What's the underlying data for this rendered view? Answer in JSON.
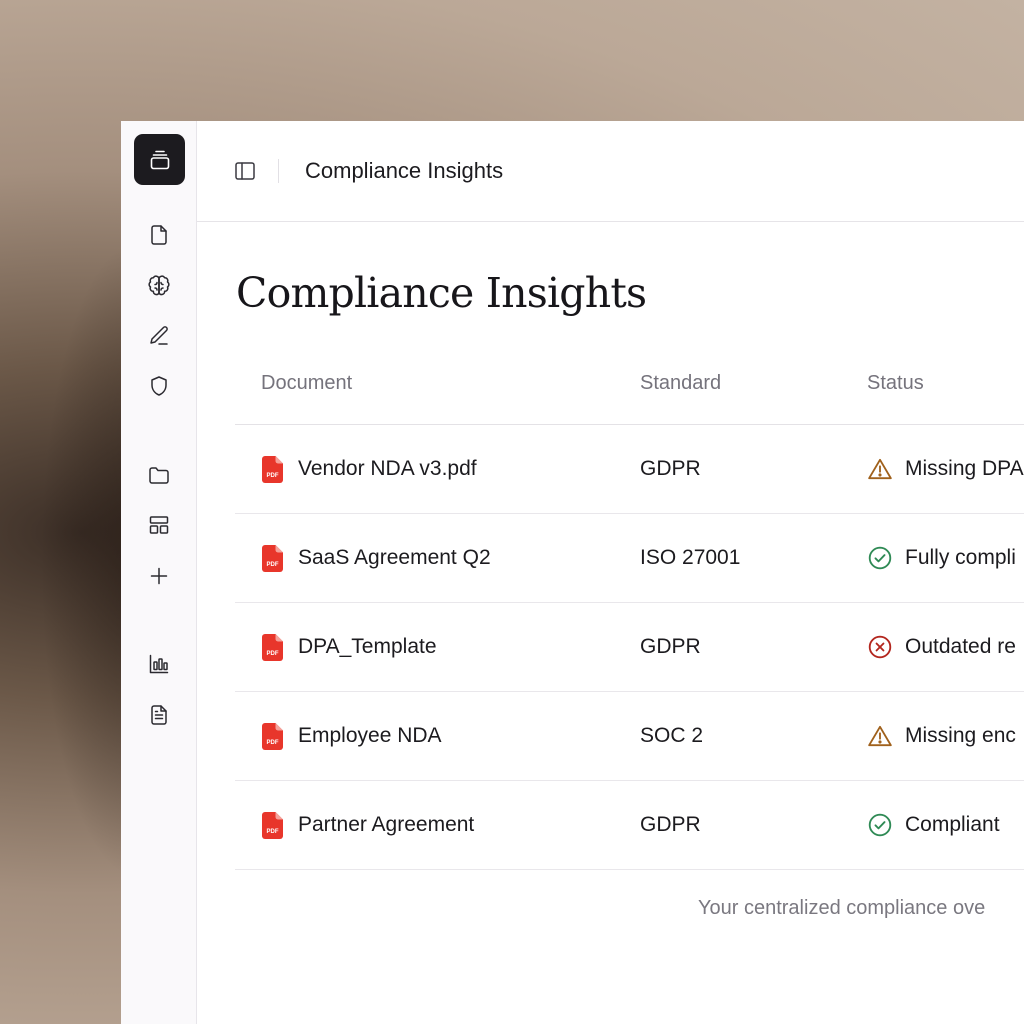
{
  "header": {
    "title": "Compliance Insights"
  },
  "page": {
    "title": "Compliance Insights"
  },
  "sidebar": {
    "logo": "stack-logo-icon",
    "items": [
      {
        "icon": "document-icon"
      },
      {
        "icon": "brain-icon"
      },
      {
        "icon": "pencil-icon"
      },
      {
        "icon": "shield-icon"
      },
      {
        "icon": "folder-icon"
      },
      {
        "icon": "layout-icon"
      },
      {
        "icon": "plus-icon"
      },
      {
        "icon": "bar-chart-icon"
      },
      {
        "icon": "file-text-icon"
      }
    ]
  },
  "table": {
    "columns": [
      "Document",
      "Standard",
      "Status"
    ],
    "rows": [
      {
        "document": "Vendor NDA v3.pdf",
        "standard": "GDPR",
        "status": "Missing DPA",
        "status_type": "warning"
      },
      {
        "document": "SaaS Agreement Q2",
        "standard": "ISO 27001",
        "status": "Fully compli",
        "status_type": "ok"
      },
      {
        "document": "DPA_Template",
        "standard": "GDPR",
        "status": "Outdated re",
        "status_type": "error"
      },
      {
        "document": "Employee NDA",
        "standard": "SOC 2",
        "status": "Missing enc",
        "status_type": "warning"
      },
      {
        "document": "Partner Agreement",
        "standard": "GDPR",
        "status": "Compliant",
        "status_type": "ok"
      }
    ]
  },
  "file_badge": "PDF",
  "footer": {
    "text": "Your centralized compliance ove"
  },
  "colors": {
    "pdf": "#e8362b",
    "warning": "#a0611c",
    "ok": "#2f8a55",
    "error": "#b3261e"
  }
}
